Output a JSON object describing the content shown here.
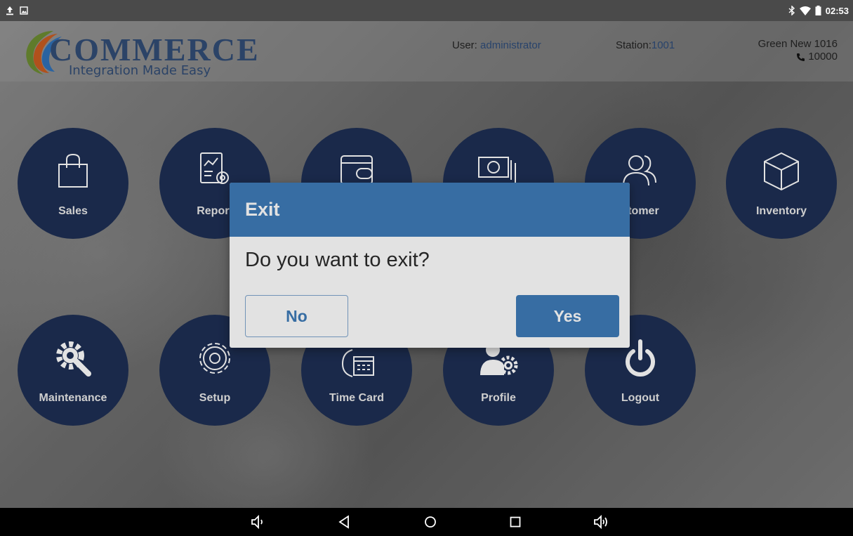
{
  "statusbar": {
    "time": "02:53"
  },
  "header": {
    "logo_word": "COMMERCE",
    "logo_tagline": "Integration Made Easy",
    "user_label": "User: ",
    "user_value": "administrator",
    "station_label": "Station:",
    "station_value": "1001",
    "store_name": "Green New 1016",
    "store_phone": "10000"
  },
  "tiles": {
    "sales": "Sales",
    "report": "Report",
    "customer": "stomer",
    "inventory": "Inventory",
    "maintenance": "Maintenance",
    "setup": "Setup",
    "timecard": "Time Card",
    "profile": "Profile",
    "logout": "Logout"
  },
  "dialog": {
    "title": "Exit",
    "message": "Do you want to exit?",
    "no_label": "No",
    "yes_label": "Yes"
  },
  "colors": {
    "tile": "#1c2d52",
    "dialog_header": "#3d7ab8",
    "logo_text": "#2f4a73"
  },
  "icons": {
    "statusbar_left": [
      "upload-icon",
      "image-icon"
    ],
    "statusbar_right": [
      "bluetooth-icon",
      "wifi-icon",
      "battery-icon"
    ],
    "navbar": [
      "volume-down-icon",
      "back-icon",
      "home-icon",
      "recents-icon",
      "volume-up-icon"
    ]
  }
}
